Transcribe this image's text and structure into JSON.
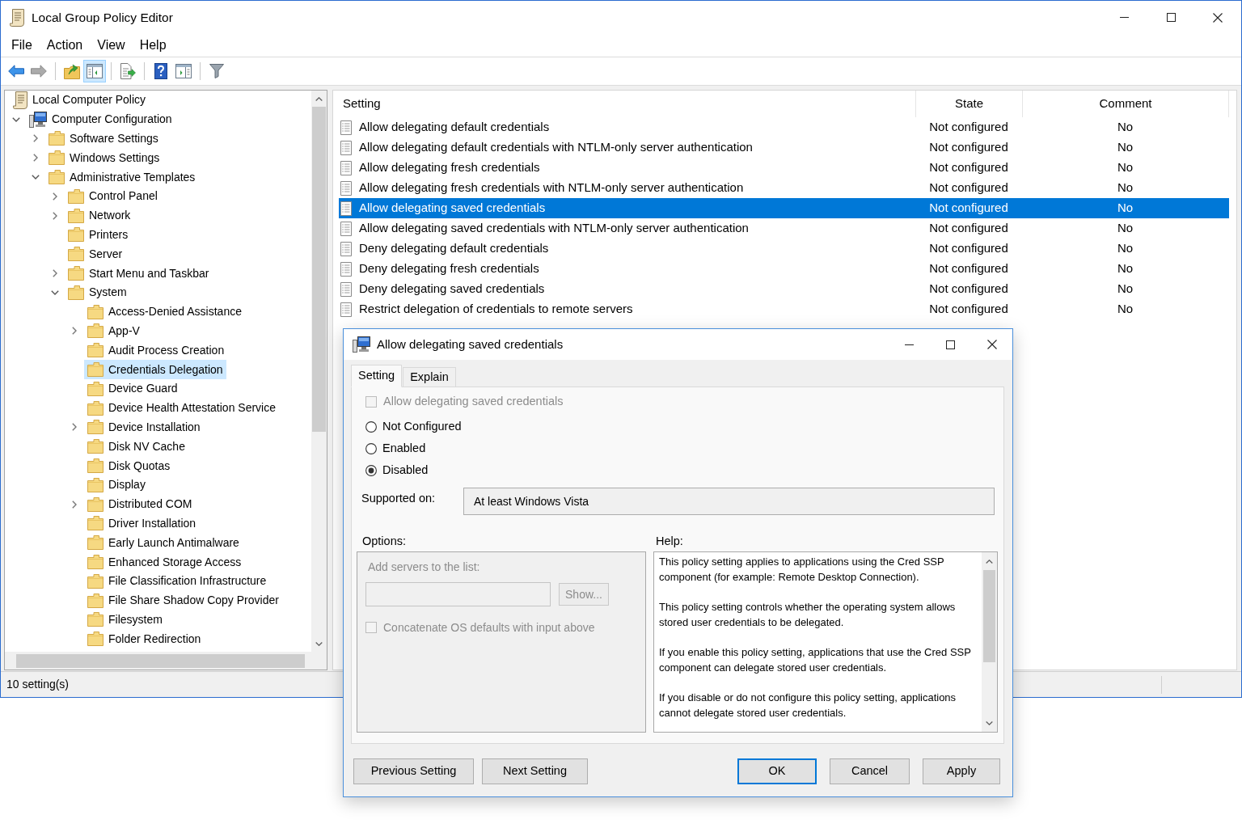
{
  "window": {
    "title": "Local Group Policy Editor"
  },
  "menu": [
    "File",
    "Action",
    "View",
    "Help"
  ],
  "toolbar": [
    [
      {
        "kind": "back",
        "disabled": false,
        "pressed": false
      },
      {
        "kind": "forward",
        "disabled": true,
        "pressed": false
      }
    ],
    [
      {
        "kind": "up",
        "disabled": false,
        "pressed": false
      },
      {
        "kind": "console-tree",
        "disabled": false,
        "pressed": true
      }
    ],
    [
      {
        "kind": "export",
        "disabled": false,
        "pressed": false
      }
    ],
    [
      {
        "kind": "help",
        "disabled": false,
        "pressed": false
      },
      {
        "kind": "action-pane",
        "disabled": false,
        "pressed": false
      }
    ],
    [
      {
        "kind": "filter",
        "disabled": false,
        "pressed": false
      }
    ]
  ],
  "tree": [
    {
      "label": "Local Computer Policy",
      "selected": false,
      "children": [
        {
          "label": "Computer Configuration",
          "expanded": true,
          "selected": false,
          "children": [
            {
              "label": "Software Settings",
              "expanded": false,
              "selected": false
            },
            {
              "label": "Windows Settings",
              "expanded": false,
              "selected": false
            },
            {
              "label": "Administrative Templates",
              "expanded": true,
              "selected": false,
              "children": [
                {
                  "label": "Control Panel",
                  "expanded": false,
                  "selected": false
                },
                {
                  "label": "Network",
                  "expanded": false,
                  "selected": false
                },
                {
                  "label": "Printers",
                  "selected": false
                },
                {
                  "label": "Server",
                  "selected": false
                },
                {
                  "label": "Start Menu and Taskbar",
                  "expanded": false,
                  "selected": false
                },
                {
                  "label": "System",
                  "expanded": true,
                  "selected": false,
                  "children": [
                    {
                      "label": "Access-Denied Assistance",
                      "selected": false
                    },
                    {
                      "label": "App-V",
                      "expanded": false,
                      "selected": false
                    },
                    {
                      "label": "Audit Process Creation",
                      "selected": false
                    },
                    {
                      "label": "Credentials Delegation",
                      "selected": true
                    },
                    {
                      "label": "Device Guard",
                      "selected": false
                    },
                    {
                      "label": "Device Health Attestation Service",
                      "selected": false
                    },
                    {
                      "label": "Device Installation",
                      "expanded": false,
                      "selected": false
                    },
                    {
                      "label": "Disk NV Cache",
                      "selected": false
                    },
                    {
                      "label": "Disk Quotas",
                      "selected": false
                    },
                    {
                      "label": "Display",
                      "selected": false
                    },
                    {
                      "label": "Distributed COM",
                      "expanded": false,
                      "selected": false
                    },
                    {
                      "label": "Driver Installation",
                      "selected": false
                    },
                    {
                      "label": "Early Launch Antimalware",
                      "selected": false
                    },
                    {
                      "label": "Enhanced Storage Access",
                      "selected": false
                    },
                    {
                      "label": "File Classification Infrastructure",
                      "selected": false
                    },
                    {
                      "label": "File Share Shadow Copy Provider",
                      "selected": false
                    },
                    {
                      "label": "Filesystem",
                      "selected": false
                    },
                    {
                      "label": "Folder Redirection",
                      "selected": false
                    }
                  ]
                }
              ]
            }
          ]
        }
      ]
    }
  ],
  "list": {
    "columns": [
      "Setting",
      "State",
      "Comment"
    ],
    "rows": [
      {
        "setting": "Allow delegating default credentials",
        "state": "Not configured",
        "comment": "No",
        "selected": false
      },
      {
        "setting": "Allow delegating default credentials with NTLM-only server authentication",
        "state": "Not configured",
        "comment": "No",
        "selected": false
      },
      {
        "setting": "Allow delegating fresh credentials",
        "state": "Not configured",
        "comment": "No",
        "selected": false
      },
      {
        "setting": "Allow delegating fresh credentials with NTLM-only server authentication",
        "state": "Not configured",
        "comment": "No",
        "selected": false
      },
      {
        "setting": "Allow delegating saved credentials",
        "state": "Not configured",
        "comment": "No",
        "selected": true
      },
      {
        "setting": "Allow delegating saved credentials with NTLM-only server authentication",
        "state": "Not configured",
        "comment": "No",
        "selected": false
      },
      {
        "setting": "Deny delegating default credentials",
        "state": "Not configured",
        "comment": "No",
        "selected": false
      },
      {
        "setting": "Deny delegating fresh credentials",
        "state": "Not configured",
        "comment": "No",
        "selected": false
      },
      {
        "setting": "Deny delegating saved credentials",
        "state": "Not configured",
        "comment": "No",
        "selected": false
      },
      {
        "setting": "Restrict delegation of credentials to remote servers",
        "state": "Not configured",
        "comment": "No",
        "selected": false
      }
    ]
  },
  "status_bar": {
    "text": "10 setting(s)"
  },
  "dialog": {
    "title": "Allow delegating saved credentials",
    "tabs": [
      {
        "label": "Setting",
        "selected": true
      },
      {
        "label": "Explain",
        "selected": false
      }
    ],
    "option_checkbox": {
      "label": "Allow delegating saved credentials",
      "checked": false,
      "disabled": true
    },
    "radios": [
      {
        "label": "Not Configured",
        "selected": false
      },
      {
        "label": "Enabled",
        "selected": false
      },
      {
        "label": "Disabled",
        "selected": true
      }
    ],
    "supported_on": {
      "label": "Supported on:",
      "value": "At least Windows Vista"
    },
    "options": {
      "label": "Options:",
      "disabled": true,
      "servers_label": "Add servers to the list:",
      "show_button": "Show...",
      "concatenate": {
        "label": "Concatenate OS defaults with input above",
        "checked": false
      }
    },
    "help": {
      "label": "Help:",
      "paragraphs": [
        "This policy setting applies to applications using the Cred SSP component (for example: Remote Desktop Connection).",
        "This policy setting controls whether the operating system allows stored user credentials to be delegated.",
        "If you enable this policy setting, applications that use the Cred SSP component can delegate stored user credentials.",
        "If you disable or do not configure this policy setting, applications cannot delegate stored user credentials."
      ]
    },
    "buttons": [
      {
        "label": "Previous Setting",
        "default": false
      },
      {
        "label": "Next Setting",
        "default": false
      },
      {
        "label": "OK",
        "default": true
      },
      {
        "label": "Cancel",
        "default": false
      },
      {
        "label": "Apply",
        "default": false
      }
    ]
  }
}
